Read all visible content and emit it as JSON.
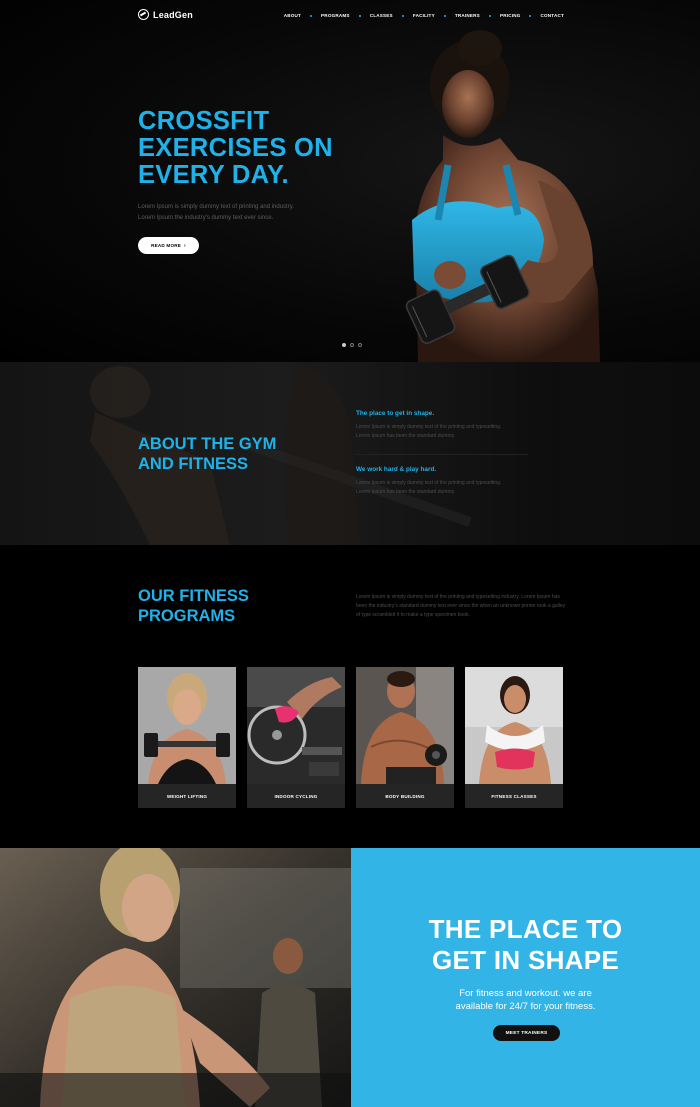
{
  "header": {
    "logo_text": "LeadGen",
    "nav": [
      "ABOUT",
      "PROGRAMS",
      "CLASSES",
      "FACILITY",
      "TRAINERS",
      "PRICING",
      "CONTACT"
    ]
  },
  "hero": {
    "title_line1": "CROSSFIT",
    "title_line2": "EXERCISES ON",
    "title_line3": "EVERY DAY.",
    "text_line1": "Lorem Ipsum is simply dummy text of printing and industry.",
    "text_line2": "Lorem Ipsum the industry's dummy text ever since.",
    "button": "READ MORE",
    "slides_total": 3,
    "slide_active": 1
  },
  "about": {
    "title_line1": "ABOUT THE GYM",
    "title_line2": "AND FITNESS",
    "blocks": [
      {
        "heading": "The place to get in shape.",
        "line1": "Lorem Ipsum is simply dummy text of the printing and typesetting.",
        "line2": "Lorem Ipsum has been the standard dummy."
      },
      {
        "heading": "We work hard & play hard.",
        "line1": "Lorem Ipsum is simply dummy text of the printing and typesetting.",
        "line2": "Lorem Ipsum has been the standard dummy."
      }
    ]
  },
  "programs": {
    "title_line1": "OUR FITNESS",
    "title_line2": "PROGRAMS",
    "text": "Lorem Ipsum is simply dummy text of the printing and typesetting industry. Lorem Ipsum has been the industry's standard dummy text ever since the when an unknown printer took a galley of type scrambled it to make a type specimen book.",
    "cards": [
      {
        "label": "WEIGHT LIFTING"
      },
      {
        "label": "INDOOR CYCLING"
      },
      {
        "label": "BODY BUILDING"
      },
      {
        "label": "FITNESS CLASSES"
      }
    ]
  },
  "cta": {
    "title_line1": "THE PLACE TO",
    "title_line2": "GET IN SHAPE",
    "text_line1": "For fitness and workout. we are",
    "text_line2": "available for 24/7 for your fitness.",
    "button": "MEET TRAINERS"
  },
  "colors": {
    "accent": "#1fb2ea",
    "cta_bg": "#33b4e6",
    "page_bg": "#000000"
  }
}
